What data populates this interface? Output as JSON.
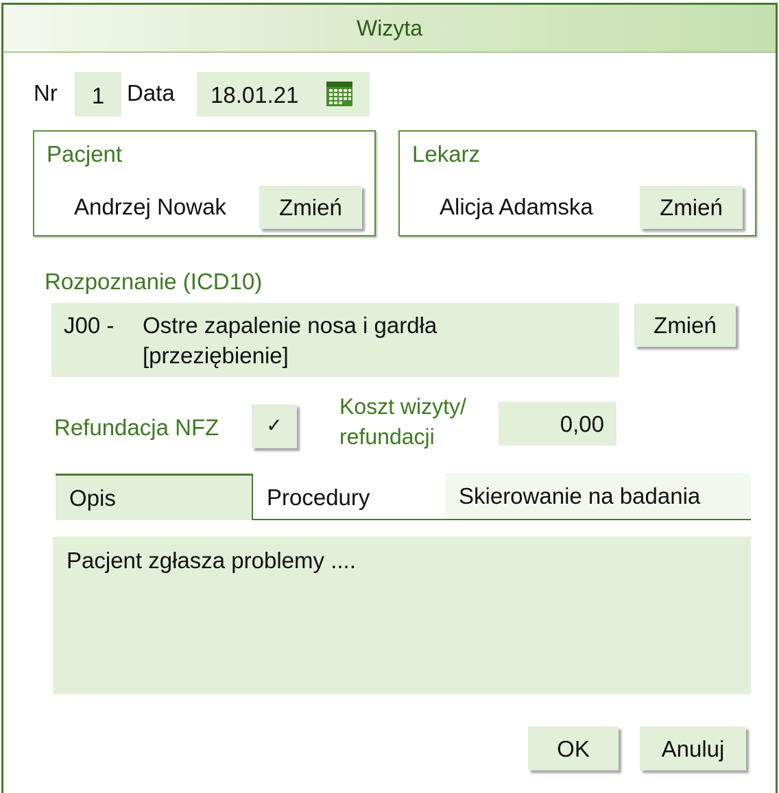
{
  "window": {
    "title": "Wizyta"
  },
  "visit": {
    "nr_label": "Nr",
    "nr_value": "1",
    "date_label": "Data",
    "date_value": "18.01.21",
    "calendar_icon": "calendar-icon"
  },
  "patient": {
    "group_label": "Pacjent",
    "name": "Andrzej Nowak",
    "change_label": "Zmień"
  },
  "doctor": {
    "group_label": "Lekarz",
    "name": "Alicja Adamska",
    "change_label": "Zmień"
  },
  "diagnosis": {
    "label": "Rozpoznanie (ICD10)",
    "code": "J00 -",
    "description_line1": "Ostre zapalenie nosa i gardła",
    "description_line2": "[przeziębienie]",
    "change_label": "Zmień"
  },
  "refund": {
    "label": "Refundacja NFZ",
    "checked_mark": "✓",
    "checked": true,
    "cost_label_line1": "Koszt wizyty/",
    "cost_label_line2": "refundacji",
    "cost_value": "0,00"
  },
  "tabs": [
    {
      "label": "Opis",
      "active": true
    },
    {
      "label": "Procedury",
      "active": false
    },
    {
      "label": "Skierowanie na badania",
      "active": false
    }
  ],
  "description_text": "Pacjent zgłasza problemy ....",
  "footer": {
    "ok_label": "OK",
    "cancel_label": "Anuluj"
  },
  "colors": {
    "accent": "#4a7a32",
    "field_background": "#e2efd9",
    "label_green": "#3d7a22",
    "title_gradient_end": "#c5e0b0"
  }
}
